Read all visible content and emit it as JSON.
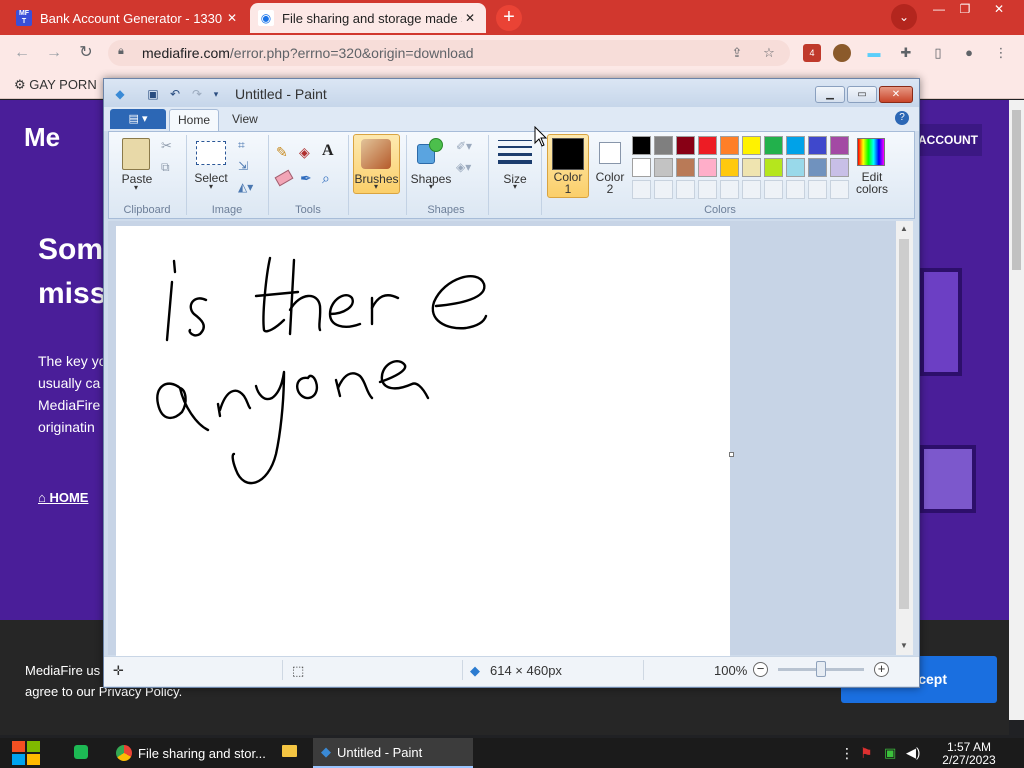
{
  "browser": {
    "tabs": [
      {
        "title": "Bank Account Generator - 1330",
        "favicon": "mft-favicon"
      },
      {
        "title": "File sharing and storage made s",
        "favicon": "mediafire-favicon"
      }
    ],
    "url_host": "mediafire.com",
    "url_path": "/error.php?errno=320&origin=download",
    "bookmark": "GAY PORN",
    "extension_badge": "4"
  },
  "website": {
    "logo_text": "Me",
    "headline": "Som miss",
    "paragraph": [
      "The key yo",
      "usually ca",
      "MediaFire",
      "originatin"
    ],
    "home_link": "HOME",
    "account_button": "ACCOUNT",
    "cookie_text_line1": "MediaFire us",
    "cookie_text_line2": "agree to our Privacy Policy.",
    "accept_button": "cept"
  },
  "paint": {
    "title": "Untitled - Paint",
    "tabs": {
      "home": "Home",
      "view": "View"
    },
    "groups": {
      "clipboard": {
        "label": "Clipboard",
        "paste": "Paste"
      },
      "image": {
        "label": "Image",
        "select": "Select"
      },
      "tools": {
        "label": "Tools"
      },
      "brushes": {
        "label": "Brushes"
      },
      "shapes": {
        "label": "Shapes",
        "shapes_btn": "Shapes"
      },
      "size": {
        "label": "Size"
      },
      "color1": {
        "line1": "Color",
        "line2": "1"
      },
      "color2": {
        "line1": "Color",
        "line2": "2"
      },
      "colors": {
        "label": "Colors"
      },
      "edit_colors": {
        "line1": "Edit",
        "line2": "colors"
      }
    },
    "palette_row1": [
      "#000000",
      "#7f7f7f",
      "#880015",
      "#ed1c24",
      "#ff7f27",
      "#fff200",
      "#22b14c",
      "#00a2e8",
      "#3f48cc",
      "#a349a4"
    ],
    "palette_row2": [
      "#ffffff",
      "#c3c3c3",
      "#b97a57",
      "#ffaec9",
      "#ffc90e",
      "#efe4b0",
      "#b5e61d",
      "#99d9ea",
      "#7092be",
      "#c8bfe7"
    ],
    "color1_value": "#000000",
    "color2_value": "#ffffff",
    "drawing_text": "is there anyone",
    "status": {
      "canvas_size": "614 × 460px",
      "zoom": "100%"
    }
  },
  "taskbar": {
    "chrome_item": "File sharing and stor...",
    "paint_item": "Untitled - Paint",
    "time": "1:57 AM",
    "date": "2/27/2023"
  }
}
